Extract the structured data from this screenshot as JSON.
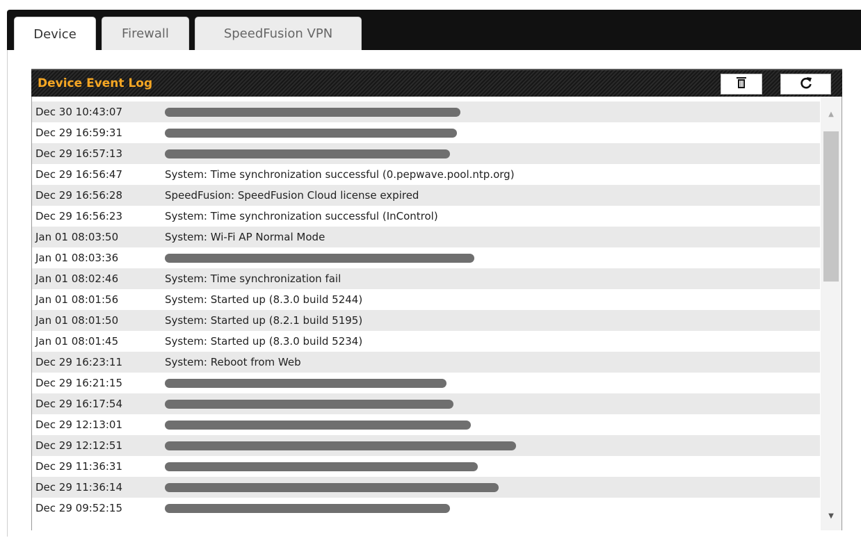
{
  "tabs": [
    {
      "label": "Device"
    },
    {
      "label": "Firewall"
    },
    {
      "label": "SpeedFusion VPN"
    }
  ],
  "log": {
    "title": "Device Event Log",
    "clear_icon": "trash-icon",
    "refresh_icon": "refresh-icon",
    "rows": [
      {
        "time": "Dec 30 10:43:07",
        "message": "",
        "redacted": true
      },
      {
        "time": "Dec 29 16:59:31",
        "message": "",
        "redacted": true
      },
      {
        "time": "Dec 29 16:57:13",
        "message": "",
        "redacted": true
      },
      {
        "time": "Dec 29 16:56:47",
        "message": "System: Time synchronization successful (0.pepwave.pool.ntp.org)",
        "redacted": false
      },
      {
        "time": "Dec 29 16:56:28",
        "message": "SpeedFusion: SpeedFusion Cloud license expired",
        "redacted": false
      },
      {
        "time": "Dec 29 16:56:23",
        "message": "System: Time synchronization successful (InControl)",
        "redacted": false
      },
      {
        "time": "Jan 01 08:03:50",
        "message": "System: Wi-Fi AP Normal Mode",
        "redacted": false
      },
      {
        "time": "Jan 01 08:03:36",
        "message": "",
        "redacted": true
      },
      {
        "time": "Jan 01 08:02:46",
        "message": "System: Time synchronization fail",
        "redacted": false
      },
      {
        "time": "Jan 01 08:01:56",
        "message": "System: Started up (8.3.0 build 5244)",
        "redacted": false
      },
      {
        "time": "Jan 01 08:01:50",
        "message": "System: Started up (8.2.1 build 5195)",
        "redacted": false
      },
      {
        "time": "Jan 01 08:01:45",
        "message": "System: Started up (8.3.0 build 5234)",
        "redacted": false
      },
      {
        "time": "Dec 29 16:23:11",
        "message": "System: Reboot from Web",
        "redacted": false
      },
      {
        "time": "Dec 29 16:21:15",
        "message": "",
        "redacted": true
      },
      {
        "time": "Dec 29 16:17:54",
        "message": "",
        "redacted": true
      },
      {
        "time": "Dec 29 12:13:01",
        "message": "",
        "redacted": true
      },
      {
        "time": "Dec 29 12:12:51",
        "message": "",
        "redacted": true
      },
      {
        "time": "Dec 29 11:36:31",
        "message": "",
        "redacted": true
      },
      {
        "time": "Dec 29 11:36:14",
        "message": "",
        "redacted": true
      },
      {
        "time": "Dec 29 09:52:15",
        "message": "",
        "redacted": true
      }
    ]
  },
  "scrollbar": {
    "up_icon": "scroll-up-arrow-icon",
    "down_icon": "scroll-down-arrow-icon"
  },
  "colors": {
    "title_accent": "#f5a623",
    "header_bg": "#1c1c1c",
    "row_alt_bg": "#e9e9e9"
  }
}
